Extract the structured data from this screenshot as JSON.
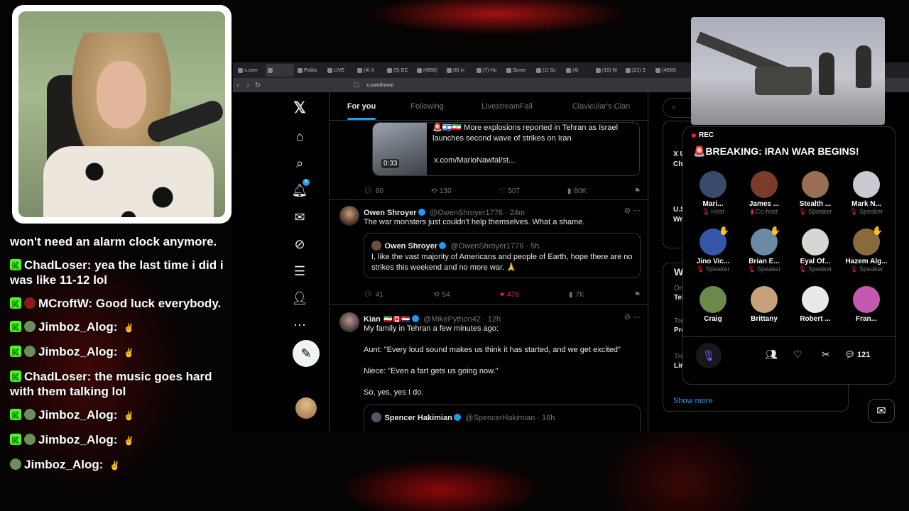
{
  "chat": [
    {
      "user": "",
      "text": "won't need an alarm clock anymore.",
      "badge": false,
      "avatar": ""
    },
    {
      "user": "ChadLoser",
      "text": "yea the last time i did i was like 11-12 lol",
      "badge": true,
      "avatar": ""
    },
    {
      "user": "MCroftW",
      "text": "Good luck everybody.",
      "badge": true,
      "avatar": "red"
    },
    {
      "user": "Jimboz_Alog",
      "text": "",
      "badge": true,
      "avatar": "green"
    },
    {
      "user": "Jimboz_Alog",
      "text": "",
      "badge": true,
      "avatar": "green"
    },
    {
      "user": "ChadLoser",
      "text": "the music goes hard with them talking lol",
      "badge": true,
      "avatar": ""
    },
    {
      "user": "Jimboz_Alog",
      "text": "",
      "badge": true,
      "avatar": "green"
    },
    {
      "user": "Jimboz_Alog",
      "text": "",
      "badge": true,
      "avatar": "green"
    },
    {
      "user": "Jimboz_Alog",
      "text": "",
      "badge": false,
      "avatar": "green"
    }
  ],
  "browser": {
    "url": "x.com/home",
    "tabs": [
      "x.com",
      "",
      "Politic",
      "LIVE",
      "(4) X",
      "(5) DC",
      "(4556)",
      "(8) in",
      "(7) Ho",
      "Scree",
      "(1) Sc",
      "(4) ",
      "(10) W",
      "(21) S",
      "(4556)"
    ]
  },
  "feed_tabs": [
    "For you",
    "Following",
    "LivestreamFail",
    "Clavicular's Clan"
  ],
  "tweet1": {
    "text": "More explosions reported in Tehran as Israel launches second wave of strikes on Iran",
    "link": "x.com/MarioNawfal/st...",
    "video_time": "0:33",
    "replies": "60",
    "reposts": "130",
    "likes": "507",
    "views": "80K"
  },
  "tweet2": {
    "name": "Owen Shroyer",
    "handle": "@OwenShroyer1776 · 24m",
    "text": "The war monsters just couldn't help themselves. What a shame.",
    "quote_name": "Owen Shroyer",
    "quote_handle": "@OwenShroyer1776 · 5h",
    "quote_text": "I, like the vast majority of Americans and people of Earth, hope there are no strikes this weekend and no more war. 🙏",
    "replies": "41",
    "reposts": "54",
    "likes": "478",
    "views": "7K"
  },
  "tweet3": {
    "name": "Kian",
    "handle": "@MikePython42 · 12h",
    "line1": "My family in Tehran a few minutes ago:",
    "line2": "Aunt: \"Every loud sound makes us think it has started, and we get excited\"",
    "line3": "Niece: \"Even a fart gets us going now.\"",
    "line4": "So, yes, yes I do.",
    "quote_name": "Spencer Hakimian",
    "quote_handle": "@SpencerHakimian · 16h"
  },
  "right_column": {
    "trends": [
      "X U",
      "Ch",
      "U.S",
      "Wr",
      "W",
      "Onl",
      "Tel",
      "Tre",
      "Pro",
      "Tre",
      "Lin"
    ],
    "show_more": "Show more"
  },
  "space": {
    "rec": "REC",
    "title": "🚨BREAKING: IRAN WAR BEGINS!",
    "speakers": [
      {
        "name": "Mari...",
        "role": "Host",
        "color": "#3a4a6b"
      },
      {
        "name": "James ...",
        "role": "Co-host",
        "color": "#7a3b2a"
      },
      {
        "name": "Stealth ...",
        "role": "Speaker",
        "color": "#9a6d55"
      },
      {
        "name": "Mark N...",
        "role": "Speaker",
        "color": "#c9c9d2"
      },
      {
        "name": "Jino Vic...",
        "role": "Speaker",
        "color": "#3557a8"
      },
      {
        "name": "Brian E...",
        "role": "Speaker",
        "color": "#6b8aa3"
      },
      {
        "name": "Eyal Of...",
        "role": "Speaker",
        "color": "#d8d6d2"
      },
      {
        "name": "Hazem Alg...",
        "role": "Speaker",
        "color": "#8a6a3a"
      },
      {
        "name": "Craig",
        "role": "",
        "color": "#6b8a4a"
      },
      {
        "name": "Brittany",
        "role": "",
        "color": "#c7a27a"
      },
      {
        "name": "Robert ...",
        "role": "",
        "color": "#e9e9e9"
      },
      {
        "name": "Fran...",
        "role": "",
        "color": "#c45ab0"
      }
    ],
    "reply_count": "121"
  }
}
